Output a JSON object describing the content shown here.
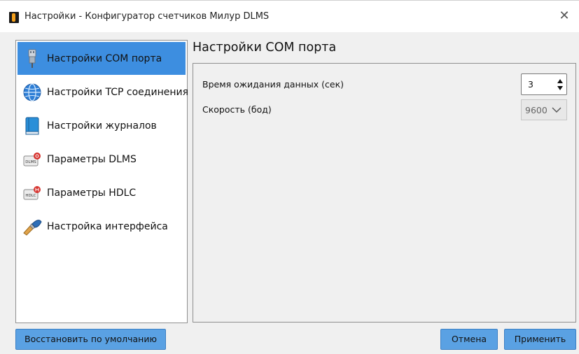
{
  "window": {
    "title": "Настройки - Конфигуратор счетчиков Милур DLMS",
    "close_symbol": "✕"
  },
  "sidebar": {
    "items": [
      {
        "label": "Настройки COM порта",
        "icon": "usb-connector-icon",
        "selected": true
      },
      {
        "label": "Настройки TCP соединения",
        "icon": "globe-icon",
        "selected": false
      },
      {
        "label": "Настройки журналов",
        "icon": "book-icon",
        "selected": false
      },
      {
        "label": "Параметры DLMS",
        "icon": "dlms-badge-icon",
        "selected": false,
        "badge_text": "DLMS"
      },
      {
        "label": "Параметры HDLC",
        "icon": "hdlc-badge-icon",
        "selected": false,
        "badge_text": "HDLC"
      },
      {
        "label": "Настройка интерфейса",
        "icon": "paint-brush-icon",
        "selected": false
      }
    ]
  },
  "panel": {
    "title": "Настройки COM порта",
    "timeout_label": "Время ожидания данных (сек)",
    "timeout_value": "3",
    "baud_label": "Скорость (бод)",
    "baud_value": "9600"
  },
  "buttons": {
    "restore_defaults": "Восстановить по умолчанию",
    "cancel": "Отмена",
    "apply": "Применить"
  },
  "colors": {
    "selection": "#3d8ee0",
    "button": "#5aa1e3",
    "window_bg": "#f0f0f0"
  }
}
